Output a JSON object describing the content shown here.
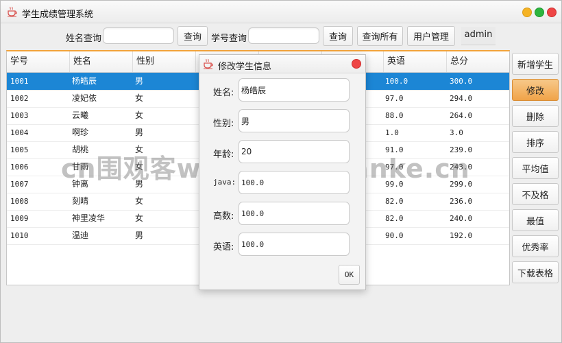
{
  "window": {
    "title": "学生成绩管理系统",
    "buttons": {
      "minimize": "minimize",
      "maximize": "maximize",
      "close": "close"
    }
  },
  "toolbar": {
    "name_query_label": "姓名查询",
    "name_query_value": "",
    "name_query_button": "查询",
    "id_query_label": "学号查询",
    "id_query_value": "",
    "id_query_button": "查询",
    "query_all_button": "查询所有",
    "user_manage_button": "用户管理",
    "current_user": "admin"
  },
  "table": {
    "columns": [
      "学号",
      "姓名",
      "性别",
      "",
      "",
      "",
      "英语",
      "总分"
    ],
    "selected_row": 0,
    "rows": [
      {
        "id": "1001",
        "name": "杨皓辰",
        "gender": "男",
        "english": "100.0",
        "total": "300.0"
      },
      {
        "id": "1002",
        "name": "凌妃依",
        "gender": "女",
        "english": "97.0",
        "total": "294.0"
      },
      {
        "id": "1003",
        "name": "云曦",
        "gender": "女",
        "english": "88.0",
        "total": "264.0"
      },
      {
        "id": "1004",
        "name": "啊珍",
        "gender": "男",
        "english": "1.0",
        "total": "3.0"
      },
      {
        "id": "1005",
        "name": "胡桃",
        "gender": "女",
        "english": "91.0",
        "total": "239.0"
      },
      {
        "id": "1006",
        "name": "甘雨",
        "gender": "女",
        "english": "97.0",
        "total": "243.0"
      },
      {
        "id": "1007",
        "name": "钟离",
        "gender": "男",
        "english": "99.0",
        "total": "299.0"
      },
      {
        "id": "1008",
        "name": "刻晴",
        "gender": "女",
        "english": "82.0",
        "total": "236.0"
      },
      {
        "id": "1009",
        "name": "神里凌华",
        "gender": "女",
        "english": "82.0",
        "total": "240.0"
      },
      {
        "id": "1010",
        "name": "温迪",
        "gender": "男",
        "english": "90.0",
        "total": "192.0"
      }
    ]
  },
  "side_buttons": [
    {
      "label": "新增学生",
      "active": false
    },
    {
      "label": "修改",
      "active": true
    },
    {
      "label": "删除",
      "active": false
    },
    {
      "label": "排序",
      "active": false
    },
    {
      "label": "平均值",
      "active": false
    },
    {
      "label": "不及格",
      "active": false
    },
    {
      "label": "最值",
      "active": false
    },
    {
      "label": "优秀率",
      "active": false
    },
    {
      "label": "下载表格",
      "active": false
    }
  ],
  "dialog": {
    "title": "修改学生信息",
    "fields": [
      {
        "label": "姓名:",
        "value": "杨皓辰"
      },
      {
        "label": "性别:",
        "value": "男"
      },
      {
        "label": "年龄:",
        "value": "20"
      },
      {
        "label": "java:",
        "value": "100.0"
      },
      {
        "label": "高数:",
        "value": "100.0"
      },
      {
        "label": "英语:",
        "value": "100.0"
      }
    ],
    "ok_button": "OK"
  },
  "watermark": "cn围观客www.weiguanke.cn",
  "colors": {
    "accent": "#f2a33a",
    "selection": "#1c86d5",
    "active_button": "#f0a348",
    "close": "#ee4545",
    "minimize": "#f5b324",
    "maximize": "#2db53f"
  }
}
